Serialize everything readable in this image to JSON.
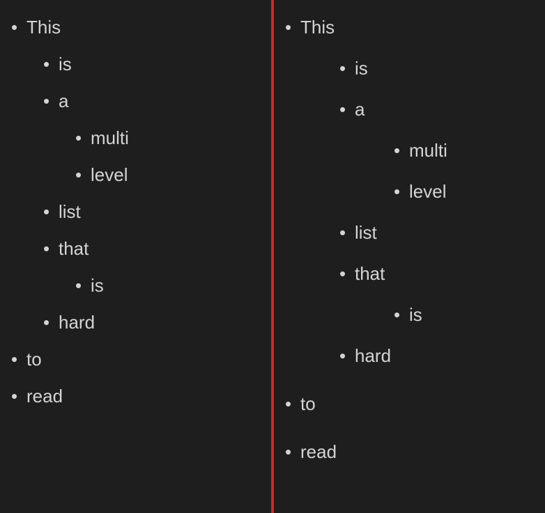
{
  "left": {
    "items": [
      {
        "text": "This",
        "children": [
          {
            "text": "is"
          },
          {
            "text": "a",
            "children": [
              {
                "text": "multi"
              },
              {
                "text": "level"
              }
            ]
          },
          {
            "text": "list"
          },
          {
            "text": "that",
            "children": [
              {
                "text": "is"
              }
            ]
          },
          {
            "text": "hard"
          }
        ]
      },
      {
        "text": "to"
      },
      {
        "text": "read"
      }
    ]
  },
  "right": {
    "items": [
      {
        "text": "This",
        "children": [
          {
            "text": "is"
          },
          {
            "text": "a",
            "children": [
              {
                "text": "multi"
              },
              {
                "text": "level"
              }
            ]
          },
          {
            "text": "list"
          },
          {
            "text": "that",
            "children": [
              {
                "text": "is"
              }
            ]
          },
          {
            "text": "hard"
          }
        ]
      },
      {
        "text": "to"
      },
      {
        "text": "read"
      }
    ]
  }
}
